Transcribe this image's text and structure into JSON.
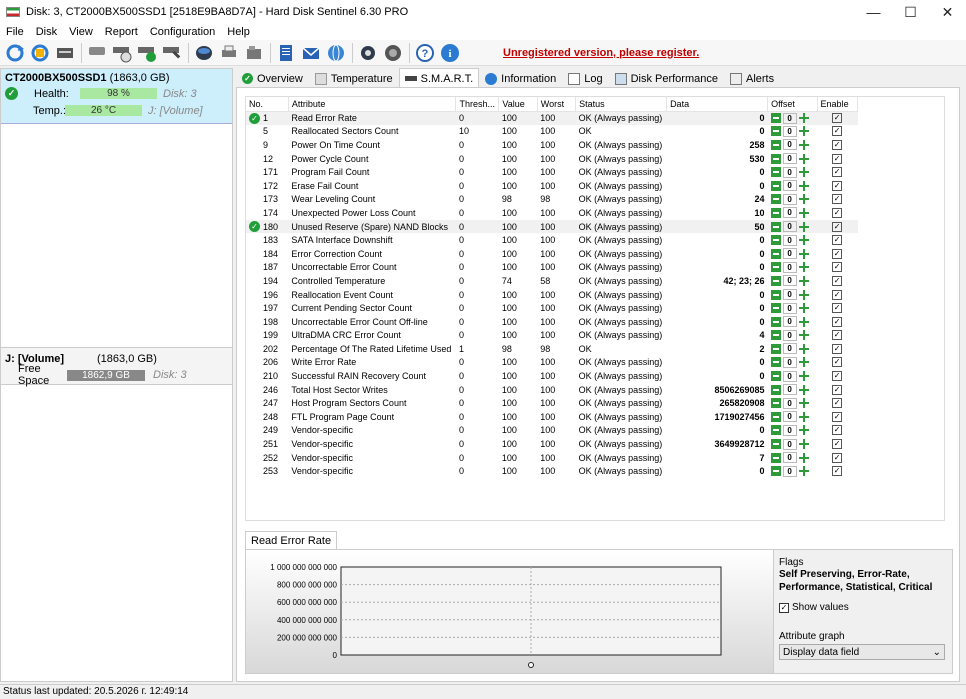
{
  "window": {
    "title": "Disk: 3, CT2000BX500SSD1 [2518E9BA8D7A]  -  Hard Disk Sentinel 6.30 PRO"
  },
  "menu": [
    "File",
    "Disk",
    "View",
    "Report",
    "Configuration",
    "Help"
  ],
  "toolbar": {
    "icons": [
      "refresh-icon",
      "disk-refresh-icon",
      "disk-icon",
      "hdd-icon",
      "hdd-schedule-icon",
      "hdd-ok-icon",
      "hdd-wrench-icon",
      "disk-save-icon",
      "printer-icon",
      "folder-icon",
      "report-icon",
      "email-icon",
      "globe-icon",
      "settings-icon",
      "speaker-icon",
      "help-icon",
      "info-icon"
    ],
    "unregistered_text": "Unregistered version, please register."
  },
  "disk": {
    "name": "CT2000BX500SSD1",
    "size": "(1863,0 GB)",
    "health_label": "Health:",
    "health_value": "98 %",
    "health_disk": "Disk: 3",
    "temp_label": "Temp.:",
    "temp_value": "26 °C",
    "temp_volume": "J: [Volume]"
  },
  "volume": {
    "name": "J: [Volume]",
    "size": "(1863,0 GB)",
    "free_label": "Free Space",
    "free_value": "1862,9 GB",
    "disk": "Disk: 3"
  },
  "tabs": [
    "Overview",
    "Temperature",
    "S.M.A.R.T.",
    "Information",
    "Log",
    "Disk Performance",
    "Alerts"
  ],
  "smart_table": {
    "headers": [
      "No.",
      "Attribute",
      "Thresh...",
      "Value",
      "Worst",
      "Status",
      "Data",
      "Offset",
      "Enable"
    ],
    "rows": [
      {
        "no": "1",
        "attr": "Read Error Rate",
        "th": "0",
        "val": "100",
        "worst": "100",
        "status": "OK (Always passing)",
        "data": "0",
        "ok": true
      },
      {
        "no": "5",
        "attr": "Reallocated Sectors Count",
        "th": "10",
        "val": "100",
        "worst": "100",
        "status": "OK",
        "data": "0"
      },
      {
        "no": "9",
        "attr": "Power On Time Count",
        "th": "0",
        "val": "100",
        "worst": "100",
        "status": "OK (Always passing)",
        "data": "258"
      },
      {
        "no": "12",
        "attr": "Power Cycle Count",
        "th": "0",
        "val": "100",
        "worst": "100",
        "status": "OK (Always passing)",
        "data": "530"
      },
      {
        "no": "171",
        "attr": "Program Fail Count",
        "th": "0",
        "val": "100",
        "worst": "100",
        "status": "OK (Always passing)",
        "data": "0"
      },
      {
        "no": "172",
        "attr": "Erase Fail Count",
        "th": "0",
        "val": "100",
        "worst": "100",
        "status": "OK (Always passing)",
        "data": "0"
      },
      {
        "no": "173",
        "attr": "Wear Leveling Count",
        "th": "0",
        "val": "98",
        "worst": "98",
        "status": "OK (Always passing)",
        "data": "24"
      },
      {
        "no": "174",
        "attr": "Unexpected Power Loss Count",
        "th": "0",
        "val": "100",
        "worst": "100",
        "status": "OK (Always passing)",
        "data": "10"
      },
      {
        "no": "180",
        "attr": "Unused Reserve (Spare) NAND Blocks",
        "th": "0",
        "val": "100",
        "worst": "100",
        "status": "OK (Always passing)",
        "data": "50",
        "ok": true
      },
      {
        "no": "183",
        "attr": "SATA Interface Downshift",
        "th": "0",
        "val": "100",
        "worst": "100",
        "status": "OK (Always passing)",
        "data": "0"
      },
      {
        "no": "184",
        "attr": "Error Correction Count",
        "th": "0",
        "val": "100",
        "worst": "100",
        "status": "OK (Always passing)",
        "data": "0"
      },
      {
        "no": "187",
        "attr": "Uncorrectable Error Count",
        "th": "0",
        "val": "100",
        "worst": "100",
        "status": "OK (Always passing)",
        "data": "0"
      },
      {
        "no": "194",
        "attr": "Controlled Temperature",
        "th": "0",
        "val": "74",
        "worst": "58",
        "status": "OK (Always passing)",
        "data": "42; 23; 26"
      },
      {
        "no": "196",
        "attr": "Reallocation Event Count",
        "th": "0",
        "val": "100",
        "worst": "100",
        "status": "OK (Always passing)",
        "data": "0"
      },
      {
        "no": "197",
        "attr": "Current Pending Sector Count",
        "th": "0",
        "val": "100",
        "worst": "100",
        "status": "OK (Always passing)",
        "data": "0"
      },
      {
        "no": "198",
        "attr": "Uncorrectable Error Count Off-line",
        "th": "0",
        "val": "100",
        "worst": "100",
        "status": "OK (Always passing)",
        "data": "0"
      },
      {
        "no": "199",
        "attr": "UltraDMA CRC Error Count",
        "th": "0",
        "val": "100",
        "worst": "100",
        "status": "OK (Always passing)",
        "data": "4"
      },
      {
        "no": "202",
        "attr": "Percentage Of The Rated Lifetime Used",
        "th": "1",
        "val": "98",
        "worst": "98",
        "status": "OK",
        "data": "2"
      },
      {
        "no": "206",
        "attr": "Write Error Rate",
        "th": "0",
        "val": "100",
        "worst": "100",
        "status": "OK (Always passing)",
        "data": "0"
      },
      {
        "no": "210",
        "attr": "Successful RAIN Recovery Count",
        "th": "0",
        "val": "100",
        "worst": "100",
        "status": "OK (Always passing)",
        "data": "0"
      },
      {
        "no": "246",
        "attr": "Total Host Sector Writes",
        "th": "0",
        "val": "100",
        "worst": "100",
        "status": "OK (Always passing)",
        "data": "8506269085"
      },
      {
        "no": "247",
        "attr": "Host Program Sectors Count",
        "th": "0",
        "val": "100",
        "worst": "100",
        "status": "OK (Always passing)",
        "data": "265820908"
      },
      {
        "no": "248",
        "attr": "FTL Program Page Count",
        "th": "0",
        "val": "100",
        "worst": "100",
        "status": "OK (Always passing)",
        "data": "1719027456"
      },
      {
        "no": "249",
        "attr": "Vendor-specific",
        "th": "0",
        "val": "100",
        "worst": "100",
        "status": "OK (Always passing)",
        "data": "0"
      },
      {
        "no": "251",
        "attr": "Vendor-specific",
        "th": "0",
        "val": "100",
        "worst": "100",
        "status": "OK (Always passing)",
        "data": "3649928712"
      },
      {
        "no": "252",
        "attr": "Vendor-specific",
        "th": "0",
        "val": "100",
        "worst": "100",
        "status": "OK (Always passing)",
        "data": "7"
      },
      {
        "no": "253",
        "attr": "Vendor-specific",
        "th": "0",
        "val": "100",
        "worst": "100",
        "status": "OK (Always passing)",
        "data": "0"
      }
    ],
    "offset_value": "0"
  },
  "graph": {
    "tab": "Read Error Rate",
    "flags_title": "Flags",
    "flags_value": "Self Preserving, Error-Rate, Performance, Statistical, Critical",
    "show_values": "Show values",
    "attribute_graph_label": "Attribute graph",
    "attribute_graph_value": "Display data field"
  },
  "chart_data": {
    "type": "line",
    "title": "Read Error Rate",
    "y_ticks": [
      "1 000 000 000 000",
      "800 000 000 000",
      "600 000 000 000",
      "400 000 000 000",
      "200 000 000 000",
      "0"
    ],
    "ylim": [
      0,
      1000000000000
    ],
    "x_ticks": [
      ""
    ],
    "series": [
      {
        "values": [
          0
        ]
      }
    ],
    "grid": true
  },
  "status": "Status last updated: 20.5.2026 г. 12:49:14"
}
